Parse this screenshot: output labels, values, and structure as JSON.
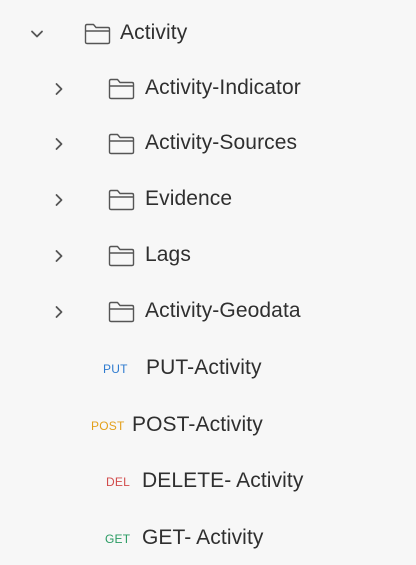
{
  "collection": {
    "root_folder": {
      "label": "Activity",
      "expanded": true,
      "icon": "folder-icon",
      "chevron": "chevron-down-icon"
    },
    "subfolders": [
      {
        "label": "Activity-Indicator",
        "expanded": false,
        "icon": "folder-icon",
        "chevron": "chevron-right-icon"
      },
      {
        "label": "Activity-Sources",
        "expanded": false,
        "icon": "folder-icon",
        "chevron": "chevron-right-icon"
      },
      {
        "label": "Evidence",
        "expanded": false,
        "icon": "folder-icon",
        "chevron": "chevron-right-icon"
      },
      {
        "label": "Lags",
        "expanded": false,
        "icon": "folder-icon",
        "chevron": "chevron-right-icon"
      },
      {
        "label": "Activity-Geodata",
        "expanded": false,
        "icon": "folder-icon",
        "chevron": "chevron-right-icon"
      }
    ],
    "requests": [
      {
        "method": "PUT",
        "label": "PUT-Activity",
        "method_color": "#2e7bcf"
      },
      {
        "method": "POST",
        "label": "POST-Activity",
        "method_color": "#e3a01b"
      },
      {
        "method": "DEL",
        "label": "DELETE- Activity",
        "method_color": "#d24c4c"
      },
      {
        "method": "GET",
        "label": "GET- Activity",
        "method_color": "#2a9b63"
      }
    ]
  },
  "colors": {
    "background": "#f7f7f7",
    "text": "#2f2f2f",
    "icon": "#555555"
  }
}
